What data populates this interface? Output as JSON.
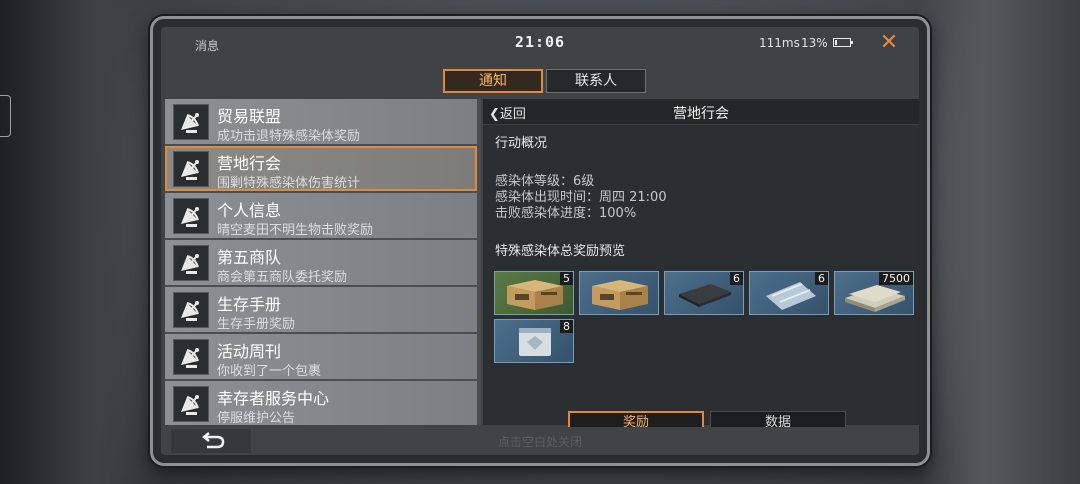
{
  "status": {
    "app_label": "消息",
    "time": "21:06",
    "ping": "111ms",
    "battery": "13%",
    "battery_level": 0.13
  },
  "tabs": [
    {
      "label": "通知",
      "active": true
    },
    {
      "label": "联系人",
      "active": false
    }
  ],
  "messages": [
    {
      "title": "贸易联盟",
      "subtitle": "成功击退特殊感染体奖励",
      "icon": "satellite-dish-icon"
    },
    {
      "title": "营地行会",
      "subtitle": "围剿特殊感染体伤害统计",
      "icon": "satellite-dish-icon",
      "selected": true
    },
    {
      "title": "个人信息",
      "subtitle": "晴空麦田不明生物击败奖励",
      "icon": "satellite-dish-icon"
    },
    {
      "title": "第五商队",
      "subtitle": "商会第五商队委托奖励",
      "icon": "satellite-dish-icon"
    },
    {
      "title": "生存手册",
      "subtitle": "生存手册奖励",
      "icon": "satellite-dish-icon"
    },
    {
      "title": "活动周刊",
      "subtitle": "你收到了一个包裹",
      "icon": "satellite-dish-icon"
    },
    {
      "title": "幸存者服务中心",
      "subtitle": "停服维护公告",
      "icon": "satellite-dish-icon"
    }
  ],
  "detail": {
    "back_label": "返回",
    "title": "营地行会",
    "overview_heading": "行动概况",
    "stats": [
      "感染体等级：6级",
      "感染体出现时间：周四 21:00",
      "击败感染体进度：100%"
    ],
    "rewards_heading": "特殊感染体总奖励预览",
    "rewards": [
      {
        "item": "supply-crate",
        "count": "5",
        "rarity": "green"
      },
      {
        "item": "supply-crate",
        "count": "",
        "rarity": "blue"
      },
      {
        "item": "metal-plate",
        "count": "6",
        "rarity": "blue"
      },
      {
        "item": "cloth-roll",
        "count": "6",
        "rarity": "blue"
      },
      {
        "item": "cash-bundle",
        "count": "7500",
        "rarity": "blue"
      },
      {
        "item": "sealed-bag",
        "count": "8",
        "rarity": "blue"
      }
    ],
    "buttons": {
      "reward": "奖励",
      "data": "数据"
    }
  },
  "footer": {
    "hint": "点击空白处关闭"
  },
  "colors": {
    "accent": "#e08a3a",
    "panel": "#2c2f31",
    "list_item": "#8c9092"
  }
}
